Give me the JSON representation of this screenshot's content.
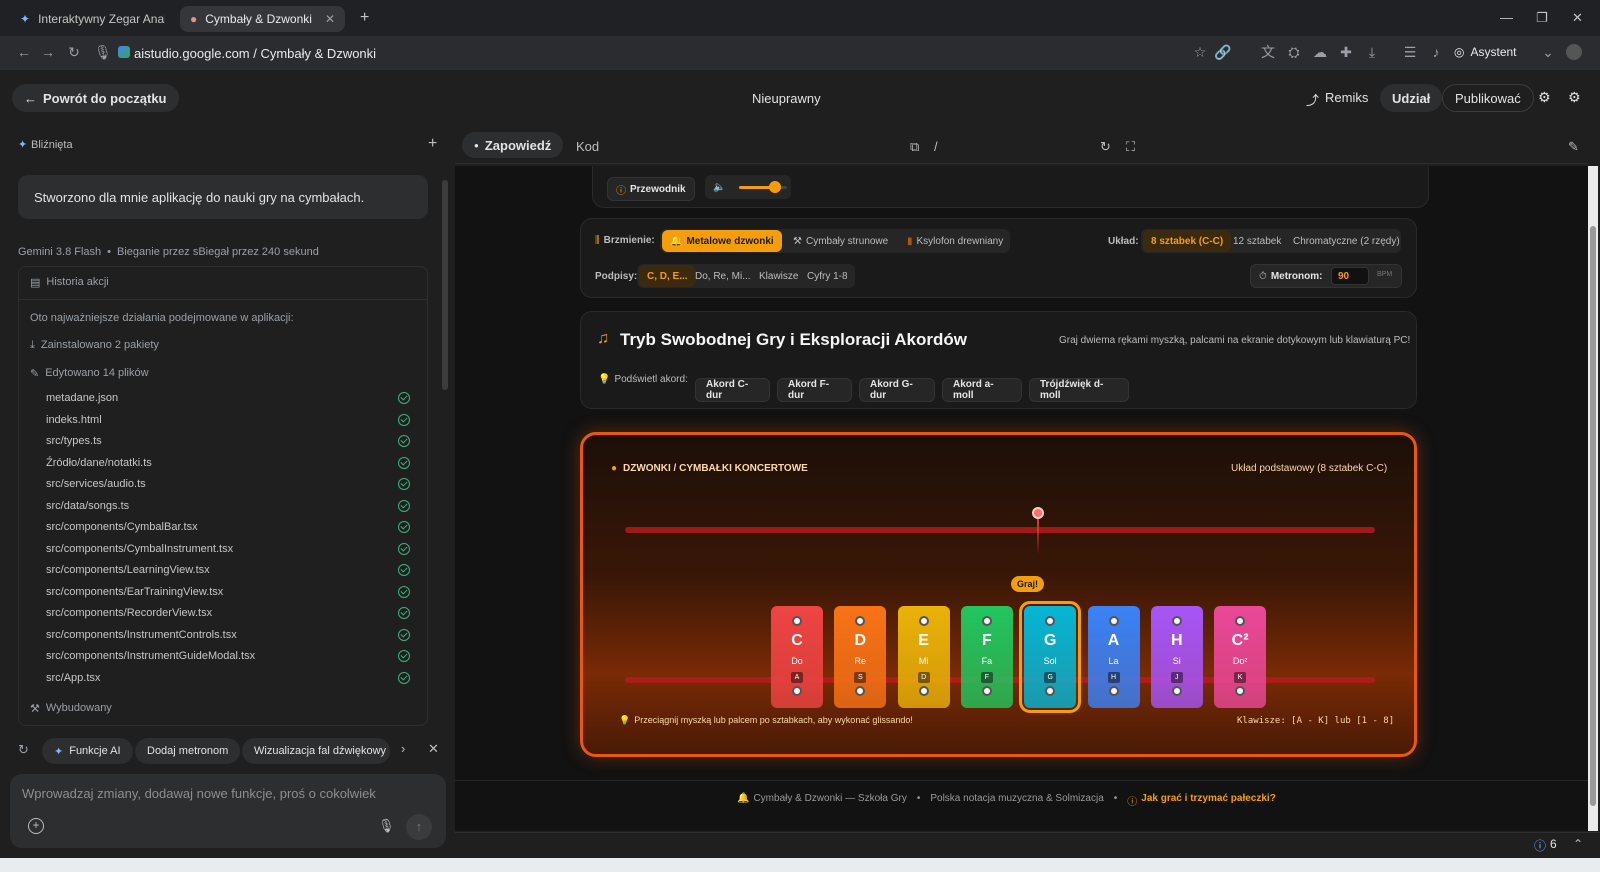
{
  "browser": {
    "tabs": [
      {
        "title": "Interaktywny Zegar Analo"
      },
      {
        "title": "Cymbały & Dzwonki - Szk"
      }
    ],
    "url": "aistudio.google.com / Cymbały & Dzwonki",
    "assistant_label": "Asystent"
  },
  "header": {
    "back_label": "Powrót do początku",
    "title": "Nieuprawny",
    "remix_label": "Remiks",
    "share_label": "Udział",
    "publish_label": "Publikować"
  },
  "left": {
    "section_label": "Bliźnięta",
    "user_message": "Stworzono dla mnie aplikację do nauki gry na cymbałach.",
    "model_info": "Gemini 3.8 Flash",
    "run_info": "Bieganie przez sBiegał przez 240 sekund",
    "history_label": "Historia akcji",
    "history_intro": "Oto najważniejsze działania podejmowane w aplikacji:",
    "installed_label": "Zainstalowano 2 pakiety",
    "edited_label": "Edytowano 14 plików",
    "files": [
      "metadane.json",
      "indeks.html",
      "src/types.ts",
      "Źródło/dane/notatki.ts",
      "src/services/audio.ts",
      "src/data/songs.ts",
      "src/components/CymbalBar.tsx",
      "src/components/CymbalInstrument.tsx",
      "src/components/LearningView.tsx",
      "src/components/EarTrainingView.tsx",
      "src/components/RecorderView.tsx",
      "src/components/InstrumentControls.tsx",
      "src/components/InstrumentGuideModal.tsx",
      "src/App.tsx"
    ],
    "built_label": "Wybudowany",
    "suggestions": [
      "Funkcje AI",
      "Dodaj metronom",
      "Wizualizacja fal dźwiękowy"
    ],
    "input_placeholder": "Wprowadzaj zmiany, dodawaj nowe funkcje, proś o cokolwiek"
  },
  "preview_tabs": {
    "preview_label": "Zapowiedź",
    "code_label": "Kod",
    "path": "/"
  },
  "app": {
    "guide_label": "Przewodnik",
    "volume": 0.75,
    "sound_label": "Brzmienie:",
    "sound_options": [
      "Metalowe dzwonki",
      "Cymbały strunowe",
      "Ksylofon drewniany"
    ],
    "sound_selected": 0,
    "layout_label": "Układ:",
    "layout_options": [
      "8 sztabek (C-C)",
      "12 sztabek",
      "Chromatyczne (2 rzędy)"
    ],
    "layout_selected": 0,
    "labels_label": "Podpisy:",
    "labels_options": [
      "C, D, E...",
      "Do, Re, Mi...",
      "Klawisze",
      "Cyfry 1-8"
    ],
    "labels_selected": 0,
    "metronome_label": "Metronom:",
    "metronome_value": "90",
    "metronome_unit": "BPM",
    "mode_title": "Tryb Swobodnej Gry i Eksploracji Akordów",
    "mode_hint": "Graj dwiema rękami myszką, palcami na ekranie dotykowym lub klawiaturą PC!",
    "highlight_label": "Podświetl akord:",
    "chords": [
      "Akord C-dur",
      "Akord F-dur",
      "Akord G-dur",
      "Akord a-moll",
      "Trójdźwięk d-moll"
    ],
    "instrument_title": "DZWONKI / CYMBAŁKI KONCERTOWE",
    "instrument_layout": "Układ podstawowy (8 sztabek C-C)",
    "play_badge": "Graj!",
    "bars": [
      {
        "note": "C",
        "solf": "Do",
        "key": "A",
        "color": "#ef4444"
      },
      {
        "note": "D",
        "solf": "Re",
        "key": "S",
        "color": "#f97316"
      },
      {
        "note": "E",
        "solf": "Mi",
        "key": "D",
        "color": "#eab308"
      },
      {
        "note": "F",
        "solf": "Fa",
        "key": "F",
        "color": "#22c55e"
      },
      {
        "note": "G",
        "solf": "Sol",
        "key": "G",
        "color": "#06b6d4"
      },
      {
        "note": "A",
        "solf": "La",
        "key": "H",
        "color": "#3b82f6"
      },
      {
        "note": "H",
        "solf": "Si",
        "key": "J",
        "color": "#a855f7"
      },
      {
        "note": "C²",
        "solf": "Do²",
        "key": "K",
        "color": "#ec4899"
      }
    ],
    "active_bar": 4,
    "glissando_hint": "Przeciągnij myszką lub palcem po sztabkach, aby wykonać glissando!",
    "keys_hint": "Klawisze: [A - K] lub [1 - 8]",
    "footer_brand": "Cymbały & Dzwonki — Szkoła Gry",
    "footer_notation": "Polska notacja muzyczna & Solmizacja",
    "footer_link": "Jak grać i trzymać pałeczki?"
  },
  "status": {
    "issues_count": "6"
  }
}
